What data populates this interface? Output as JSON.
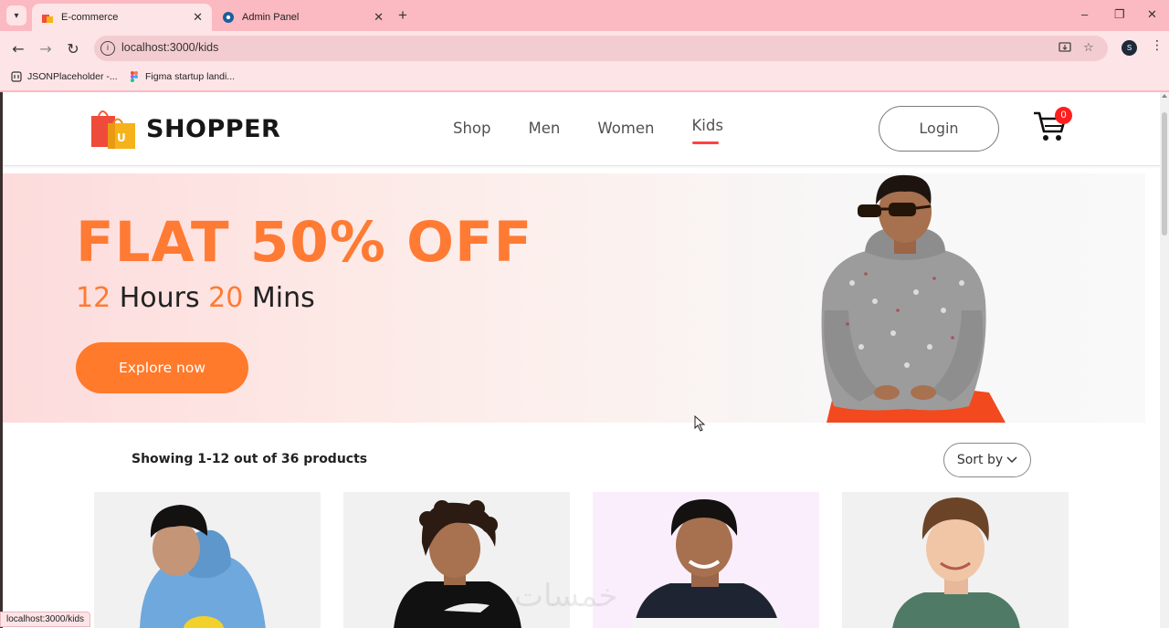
{
  "browser": {
    "tabs": [
      {
        "title": "E-commerce",
        "active": true
      },
      {
        "title": "Admin Panel",
        "active": false
      }
    ],
    "new_tab": "+",
    "url": "localhost:3000/kids",
    "window_controls": {
      "minimize": "–",
      "maximize": "❐",
      "close": "✕"
    },
    "profile_initial": "S",
    "bookmarks": [
      {
        "label": "JSONPlaceholder -..."
      },
      {
        "label": "Figma startup landi..."
      }
    ],
    "status_url": "localhost:3000/kids"
  },
  "navbar": {
    "logo_text": "SHOPPER",
    "logo_badge": "U",
    "menu": [
      {
        "label": "Shop"
      },
      {
        "label": "Men"
      },
      {
        "label": "Women"
      },
      {
        "label": "Kids",
        "active": true
      }
    ],
    "login_label": "Login",
    "cart_count": "0"
  },
  "banner": {
    "title": "FLAT 50% OFF",
    "timer": {
      "hours": "12",
      "hours_label": " Hours ",
      "mins": "20",
      "mins_label": " Mins"
    },
    "button_label": "Explore now"
  },
  "products_header": {
    "showing_text": "Showing 1-12 out of 36 products",
    "sort_label": "Sort by"
  },
  "products": [
    {
      "name": "kid-blue-hoodie"
    },
    {
      "name": "kid-black-hoodie"
    },
    {
      "name": "kid-navy-striped-top"
    },
    {
      "name": "kid-green-tee"
    }
  ],
  "watermark": "خمسات",
  "colors": {
    "accent": "#ff7a33",
    "menu_active_underline": "#ff4141",
    "cart_badge": "#ff1e1e",
    "browser_frame": "#fbb9c1"
  }
}
